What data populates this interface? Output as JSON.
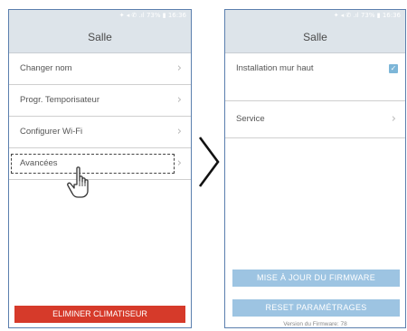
{
  "left_screen": {
    "status_text": "✦ ◂ ✆ .ıl 73% ▮ 16:36",
    "title": "Salle",
    "menu": [
      {
        "label": "Changer nom"
      },
      {
        "label": "Progr. Temporisateur"
      },
      {
        "label": "Configurer Wi-Fi"
      },
      {
        "label": "Avancées"
      }
    ],
    "delete_button": "ELIMINER CLIMATISEUR"
  },
  "right_screen": {
    "status_text": "✦ ◂ ✆ .ıl 73% ▮ 16:36",
    "title": "Salle",
    "install_label": "Installation mur haut",
    "install_checked": true,
    "service_label": "Service",
    "firmware_button": "MISE À JOUR DU FIRMWARE",
    "reset_button": "RESET PARAMÉTRAGES",
    "version_text": "Version du Firmware: 78"
  },
  "icons": {
    "chevron": "chevron-right-icon",
    "transition": "chevron-right-icon",
    "cursor": "hand-pointer-icon",
    "checkbox": "checkmark-icon"
  },
  "colors": {
    "header_bg": "#dde4ea",
    "danger": "#d63a2a",
    "primary_disabled": "#9dc4e2",
    "checkbox": "#7db6d8",
    "frame": "#5b7fae"
  }
}
